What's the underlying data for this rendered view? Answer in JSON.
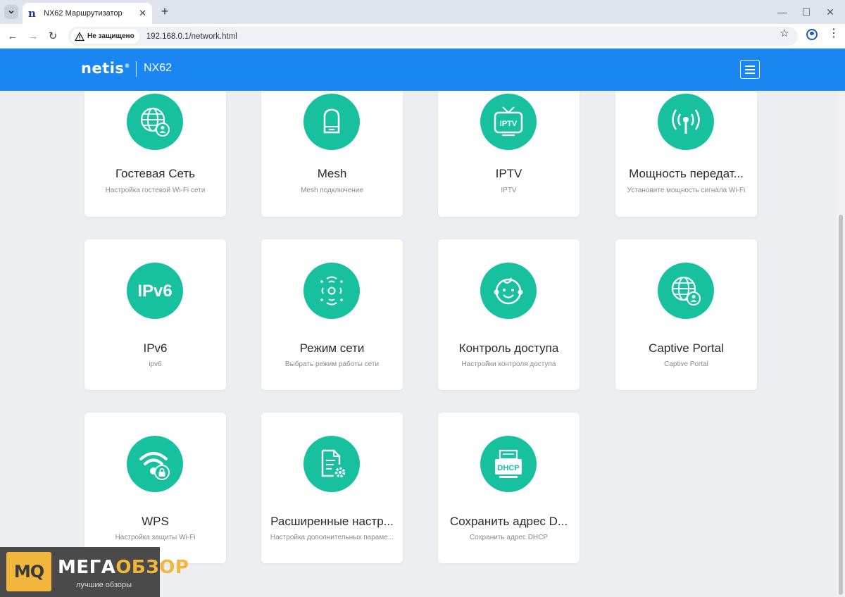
{
  "browser": {
    "tab_title": "NX62 Маршрутизатор",
    "security_label": "Не защищено",
    "url": "192.168.0.1/network.html"
  },
  "header": {
    "logo": "netis",
    "logo_mark": "®",
    "model": "NX62"
  },
  "cards": [
    {
      "title": "Гостевая Сеть",
      "subtitle": "Настройка гостевой Wi-Fi сети",
      "icon": "globe-user-icon"
    },
    {
      "title": "Mesh",
      "subtitle": "Mesh подключение",
      "icon": "mesh-device-icon"
    },
    {
      "title": "IPTV",
      "subtitle": "IPTV",
      "icon": "tv-icon",
      "icon_text": "IPTV"
    },
    {
      "title": "Мощность передат...",
      "subtitle": "Установите мощность сигнала Wi-Fi",
      "icon": "antenna-signal-icon"
    },
    {
      "title": "IPv6",
      "subtitle": "ipv6",
      "icon": "ipv6-icon",
      "icon_text": "IPv6"
    },
    {
      "title": "Режим сети",
      "subtitle": "Выбрать режим работы сети",
      "icon": "network-mode-icon"
    },
    {
      "title": "Контроль доступа",
      "subtitle": "Настройки контроля доступа",
      "icon": "child-face-icon"
    },
    {
      "title": "Captive Portal",
      "subtitle": "Captive Portal",
      "icon": "globe-user-icon"
    },
    {
      "title": "WPS",
      "subtitle": "Настройка защиты Wi-Fi",
      "icon": "wifi-lock-icon"
    },
    {
      "title": "Расширенные настр...",
      "subtitle": "Настройка дополнительных параме...",
      "icon": "document-gear-icon"
    },
    {
      "title": "Сохранить адрес D...",
      "subtitle": "Сохранить адрес DHCP",
      "icon": "dhcp-icon",
      "icon_text": "DHCP"
    }
  ],
  "watermark": {
    "logo": "MQ",
    "title_a": "МЕГА",
    "title_b": "ОБЗОР",
    "subtitle": "лучшие обзоры"
  },
  "colors": {
    "header_blue": "#1a86f2",
    "icon_green": "#17c19f"
  }
}
